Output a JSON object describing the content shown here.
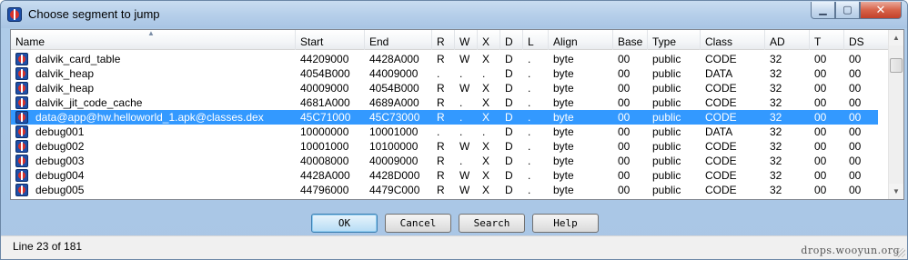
{
  "window": {
    "title": "Choose segment to jump",
    "controls": {
      "minimize": "▁",
      "maximize": "▢",
      "close": "✕"
    }
  },
  "table": {
    "columns": [
      "Name",
      "Start",
      "End",
      "R",
      "W",
      "X",
      "D",
      "L",
      "Align",
      "Base",
      "Type",
      "Class",
      "AD",
      "T",
      "DS"
    ],
    "sort_indicator": "▲",
    "rows": [
      {
        "name": "dalvik_card_table",
        "start": "44209000",
        "end": "4428A000",
        "r": "R",
        "w": "W",
        "x": "X",
        "d": "D",
        "l": ".",
        "align": "byte",
        "base": "00",
        "type": "public",
        "class": "CODE",
        "ad": "32",
        "t": "00",
        "ds": "00"
      },
      {
        "name": "dalvik_heap",
        "start": "4054B000",
        "end": "44009000",
        "r": ".",
        "w": ".",
        "x": ".",
        "d": "D",
        "l": ".",
        "align": "byte",
        "base": "00",
        "type": "public",
        "class": "DATA",
        "ad": "32",
        "t": "00",
        "ds": "00"
      },
      {
        "name": "dalvik_heap",
        "start": "40009000",
        "end": "4054B000",
        "r": "R",
        "w": "W",
        "x": "X",
        "d": "D",
        "l": ".",
        "align": "byte",
        "base": "00",
        "type": "public",
        "class": "CODE",
        "ad": "32",
        "t": "00",
        "ds": "00"
      },
      {
        "name": "dalvik_jit_code_cache",
        "start": "4681A000",
        "end": "4689A000",
        "r": "R",
        "w": ".",
        "x": "X",
        "d": "D",
        "l": ".",
        "align": "byte",
        "base": "00",
        "type": "public",
        "class": "CODE",
        "ad": "32",
        "t": "00",
        "ds": "00"
      },
      {
        "name": "data@app@hw.helloworld_1.apk@classes.dex",
        "start": "45C71000",
        "end": "45C73000",
        "r": "R",
        "w": ".",
        "x": "X",
        "d": "D",
        "l": ".",
        "align": "byte",
        "base": "00",
        "type": "public",
        "class": "CODE",
        "ad": "32",
        "t": "00",
        "ds": "00",
        "selected": true
      },
      {
        "name": "debug001",
        "start": "10000000",
        "end": "10001000",
        "r": ".",
        "w": ".",
        "x": ".",
        "d": "D",
        "l": ".",
        "align": "byte",
        "base": "00",
        "type": "public",
        "class": "DATA",
        "ad": "32",
        "t": "00",
        "ds": "00"
      },
      {
        "name": "debug002",
        "start": "10001000",
        "end": "10100000",
        "r": "R",
        "w": "W",
        "x": "X",
        "d": "D",
        "l": ".",
        "align": "byte",
        "base": "00",
        "type": "public",
        "class": "CODE",
        "ad": "32",
        "t": "00",
        "ds": "00"
      },
      {
        "name": "debug003",
        "start": "40008000",
        "end": "40009000",
        "r": "R",
        "w": ".",
        "x": "X",
        "d": "D",
        "l": ".",
        "align": "byte",
        "base": "00",
        "type": "public",
        "class": "CODE",
        "ad": "32",
        "t": "00",
        "ds": "00"
      },
      {
        "name": "debug004",
        "start": "4428A000",
        "end": "4428D000",
        "r": "R",
        "w": "W",
        "x": "X",
        "d": "D",
        "l": ".",
        "align": "byte",
        "base": "00",
        "type": "public",
        "class": "CODE",
        "ad": "32",
        "t": "00",
        "ds": "00"
      },
      {
        "name": "debug005",
        "start": "44796000",
        "end": "4479C000",
        "r": "R",
        "w": "W",
        "x": "X",
        "d": "D",
        "l": ".",
        "align": "byte",
        "base": "00",
        "type": "public",
        "class": "CODE",
        "ad": "32",
        "t": "00",
        "ds": "00"
      }
    ]
  },
  "buttons": {
    "ok": "OK",
    "cancel": "Cancel",
    "search": "Search",
    "help": "Help"
  },
  "status": {
    "line_info": "Line 23 of 181",
    "watermark": "drops.wooyun.org"
  },
  "colors": {
    "selection": "#3399ff",
    "title_gradient": "#b6cfea",
    "close_button": "#c2412a"
  }
}
